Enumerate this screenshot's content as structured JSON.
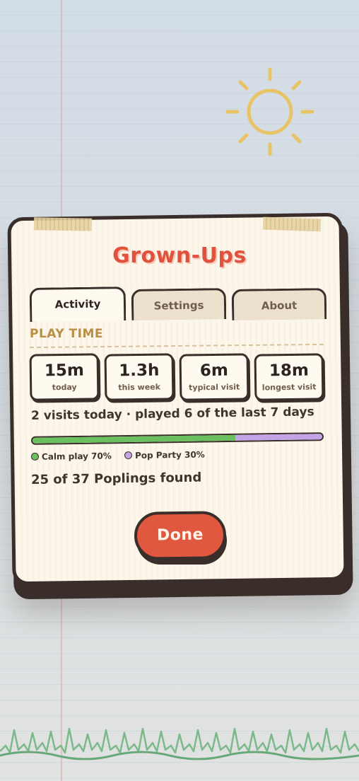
{
  "modal": {
    "title": "Grown-Ups",
    "tabs": [
      {
        "label": "Activity",
        "active": true
      },
      {
        "label": "Settings",
        "active": false
      },
      {
        "label": "About",
        "active": false
      }
    ],
    "section_label": "PLAY TIME",
    "stats": [
      {
        "value": "15m",
        "label": "today"
      },
      {
        "value": "1.3h",
        "label": "this week"
      },
      {
        "value": "6m",
        "label": "typical visit"
      },
      {
        "value": "18m",
        "label": "longest visit"
      }
    ],
    "visits_text": "2 visits today · played 6 of the last 7 days",
    "play_split": [
      {
        "label": "Calm play 70%",
        "percent": 70,
        "color": "#6abf5e"
      },
      {
        "label": "Pop Party 30%",
        "percent": 30,
        "color": "#c3a4e6"
      }
    ],
    "found_text": "25 of 37 Poplings found",
    "done_label": "Done"
  },
  "scene": {
    "sun_icon": "sun-icon",
    "grass_icon": "grass-icon"
  },
  "colors": {
    "accent": "#e0523d",
    "outline": "#3a2e2a",
    "card": "#fdf6ea",
    "section_label": "#b98f45"
  }
}
